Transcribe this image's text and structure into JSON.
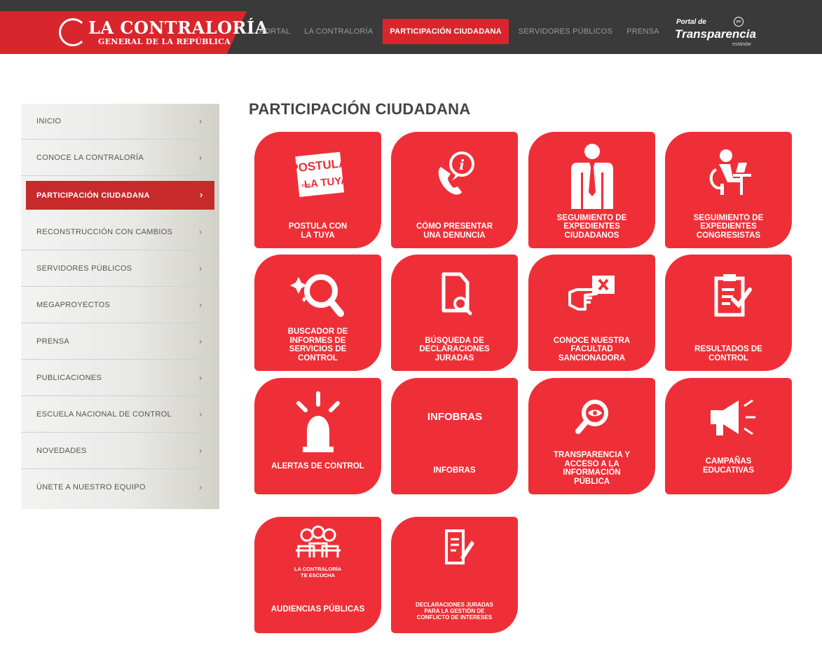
{
  "header": {
    "logo_title": "LA CONTRALORÍA",
    "logo_subtitle": "GENERAL DE LA REPÚBLICA",
    "nav": [
      "PORTAL",
      "LA CONTRALORÍA",
      "PARTICIPACIÓN CIUDADANA",
      "SERVIDORES PÚBLICOS",
      "PRENSA"
    ],
    "active_nav": "PARTICIPACIÓN CIUDADANA",
    "portal": {
      "small": "Portal de",
      "big": "Transparencia",
      "est": "estándar",
      "icon_text": "pte"
    }
  },
  "sidebar": {
    "items": [
      {
        "label": "INICIO",
        "icon": "chevron-right-icon"
      },
      {
        "label": "CONOCE LA CONTRALORÍA",
        "icon": "chevron-right-icon"
      },
      {
        "label": "PARTICIPACIÓN CIUDADANA",
        "icon": "chevron-right-icon"
      },
      {
        "label": "RECONSTRUCCIÓN CON CAMBIOS",
        "icon": "chevron-right-icon"
      },
      {
        "label": "SERVIDORES PÚBLICOS",
        "icon": "chevron-right-icon"
      },
      {
        "label": "MEGAPROYECTOS",
        "icon": "chevron-right-icon"
      },
      {
        "label": "PRENSA",
        "icon": "chevron-right-icon"
      },
      {
        "label": "PUBLICACIONES",
        "icon": "chevron-right-icon"
      },
      {
        "label": "ESCUELA NACIONAL DE CONTROL",
        "icon": "chevron-right-icon"
      },
      {
        "label": "NOVEDADES",
        "icon": "chevron-right-icon"
      },
      {
        "label": "ÚNETE A NUESTRO EQUIPO",
        "icon": "chevron-right-icon"
      }
    ],
    "chevron": "›",
    "active_index": 2
  },
  "main": {
    "title": "PARTICIPACIÓN CIUDADANA",
    "tiles": [
      {
        "label": "POSTULA CON\nLA TUYA",
        "icon": "postula-badge-icon",
        "icon_text": [
          "POSTULA",
          "con",
          "LA TUYA"
        ]
      },
      {
        "label": "CÓMO PRESENTAR\nUNA DENUNCIA",
        "icon": "phone-info-icon"
      },
      {
        "label": "SEGUIMIENTO DE\nEXPEDIENTES\nCIUDADANOS",
        "icon": "person-tie-icon"
      },
      {
        "label": "SEGUIMIENTO DE\nEXPEDIENTES\nCONGRESISTAS",
        "icon": "person-desk-icon"
      },
      {
        "label": "BUSCADOR DE\nINFORMES DE\nSERVICIOS DE\nCONTROL",
        "icon": "magnifier-sparkle-icon"
      },
      {
        "label": "BÚSQUEDA DE\nDECLARACIONES\nJURADAS",
        "icon": "document-search-icon"
      },
      {
        "label": "CONOCE NUESTRA\nFACULTAD\nSANCIONADORA",
        "icon": "hand-card-x-icon"
      },
      {
        "label": "RESULTADOS DE\nCONTROL",
        "icon": "clipboard-check-icon"
      },
      {
        "label": "ALERTAS DE CONTROL",
        "icon": "siren-icon"
      },
      {
        "label": "INFOBRAS",
        "icon": "infobras-logo-icon",
        "icon_text": "INFOBRAS"
      },
      {
        "label": "TRANSPARENCIA Y\nACCESO A LA\nINFORMACIÓN\nPÚBLICA",
        "icon": "eye-magnifier-icon"
      },
      {
        "label": "CAMPAÑAS\nEDUCATIVAS",
        "icon": "megaphone-icon"
      },
      {
        "label": "AUDIENCIAS PÚBLICAS",
        "icon": "people-group-icon",
        "icon_text": "LA CONTRALORÍA\nTE ESCUCHA"
      },
      {
        "label": "DECLARACIONES JURADAS\nPARA LA GESTIÓN DE\nCONFLICTO DE INTERESES",
        "icon": "document-pen-icon"
      }
    ]
  },
  "colors": {
    "brand_red": "#d8262c",
    "tile_red": "#ef2f37",
    "header_dark": "#3a3a3a",
    "sidebar_active": "#c62a2a"
  }
}
